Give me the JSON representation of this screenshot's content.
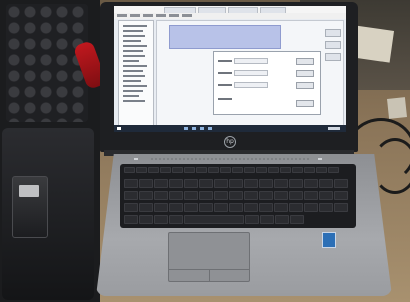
{
  "scene": {
    "description_tag": "",
    "laptop": {
      "brand_logo_glyph": "hp",
      "screen": {
        "menu_items_count": 6
      }
    }
  },
  "colors": {
    "bench": "#8a7458",
    "laptop_body": "#a7a9ad",
    "keyboard": "#1c1d20",
    "screen_bg": "#e8ecf2",
    "dialog_header": "#b8c2e8",
    "taskbar": "#1f2a3a",
    "pliers": "#c0181e",
    "intel_badge": "#2c6fb6"
  }
}
